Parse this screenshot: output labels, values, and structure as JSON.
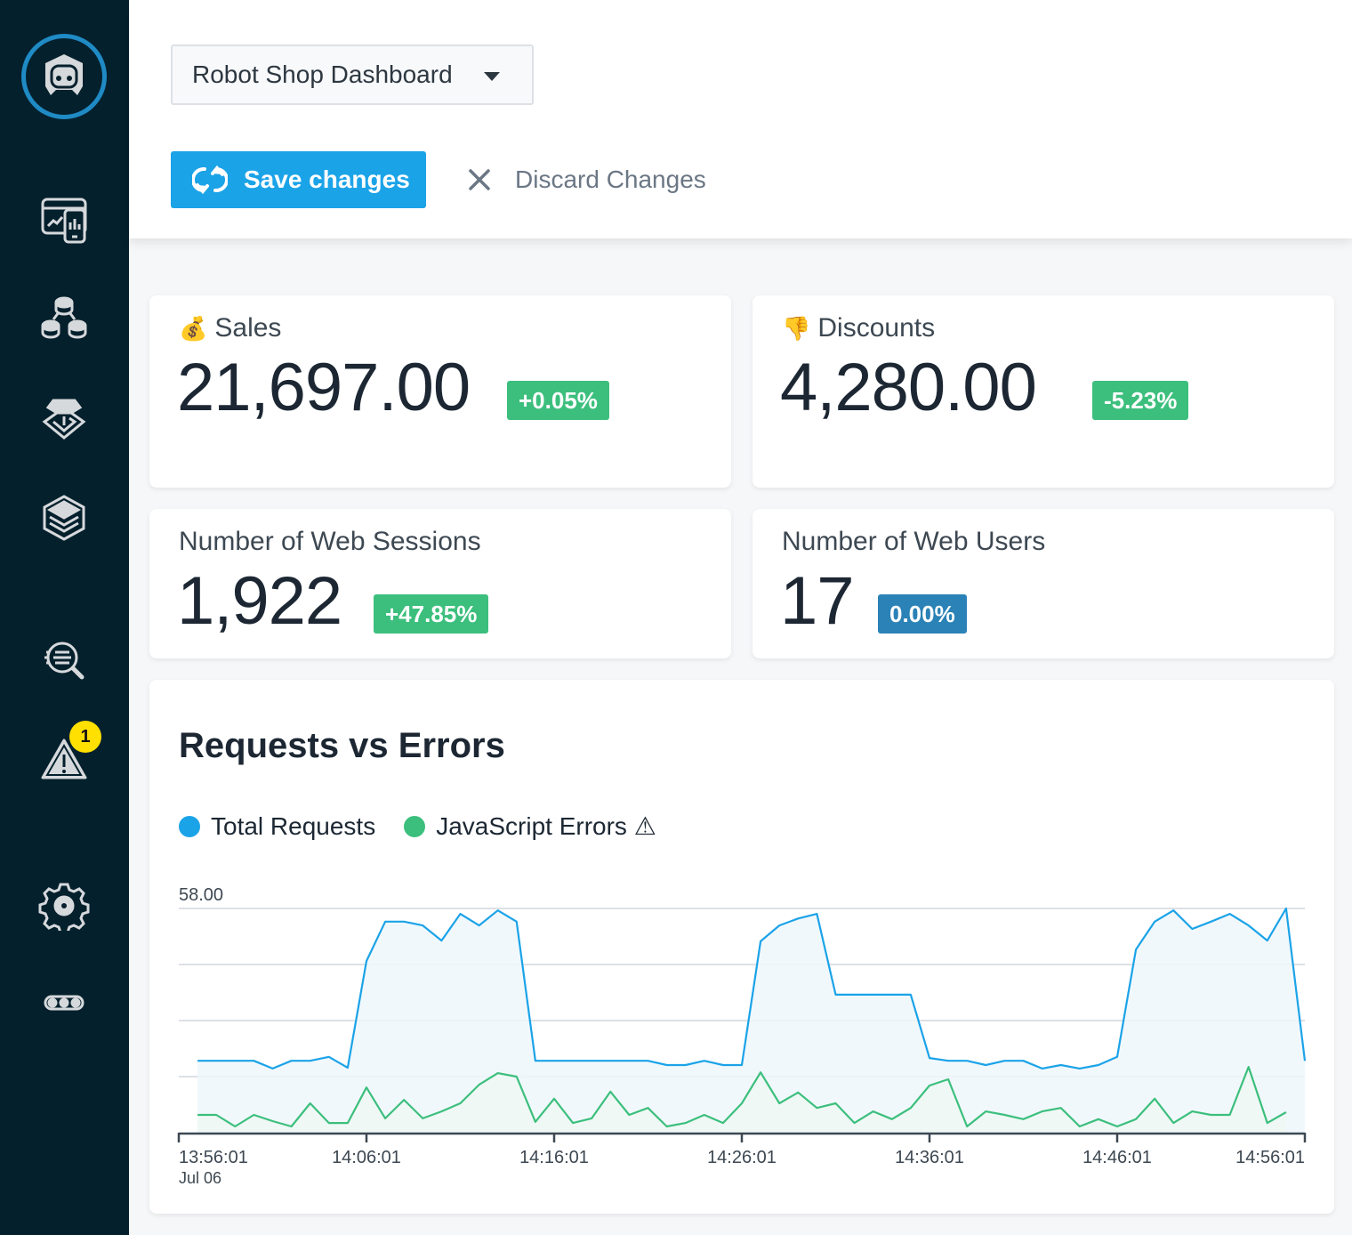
{
  "header": {
    "dashboard_select": {
      "selected": "Robot Shop Dashboard"
    },
    "save_label": "Save changes",
    "discard_label": "Discard Changes"
  },
  "sidebar": {
    "items": [
      {
        "name": "logo",
        "icon": "robot-logo-icon"
      },
      {
        "name": "monitoring",
        "icon": "browser-mobile-monitoring-icon"
      },
      {
        "name": "services",
        "icon": "services-topology-icon"
      },
      {
        "name": "infrastructure",
        "icon": "infrastructure-icon"
      },
      {
        "name": "layers",
        "icon": "layers-stack-icon"
      },
      {
        "name": "analyze",
        "icon": "search-analyze-icon"
      },
      {
        "name": "events",
        "icon": "warning-icon",
        "badge": "1"
      },
      {
        "name": "settings",
        "icon": "gear-icon"
      },
      {
        "name": "more",
        "icon": "more-icon"
      }
    ]
  },
  "metrics": [
    {
      "id": "sales",
      "emoji": "💰",
      "label": "Sales",
      "value": "21,697.00",
      "change": "+0.05%",
      "change_color": "#3cbf7d"
    },
    {
      "id": "discounts",
      "emoji": "👎",
      "label": "Discounts",
      "value": "4,280.00",
      "change": "-5.23%",
      "change_color": "#3cbf7d"
    },
    {
      "id": "sessions",
      "emoji": "",
      "label": "Number of Web Sessions",
      "value": "1,922",
      "change": "+47.85%",
      "change_color": "#3cbf7d"
    },
    {
      "id": "users",
      "emoji": "",
      "label": "Number of Web Users",
      "value": "17",
      "change": "0.00%",
      "change_color": "#2a82b6"
    }
  ],
  "chart_data": {
    "type": "area",
    "title": "Requests vs Errors",
    "xlabel": "",
    "ylabel": "",
    "y_max_label": "58.00",
    "ylim": [
      0,
      58
    ],
    "grid": true,
    "legend_position": "top-left",
    "x_range_minutes": [
      0,
      60
    ],
    "x_ticks": [
      {
        "minute": 0,
        "label": "13:56:01",
        "sublabel": "Jul 06"
      },
      {
        "minute": 10,
        "label": "14:06:01",
        "sublabel": ""
      },
      {
        "minute": 20,
        "label": "14:16:01",
        "sublabel": ""
      },
      {
        "minute": 30,
        "label": "14:26:01",
        "sublabel": ""
      },
      {
        "minute": 40,
        "label": "14:36:01",
        "sublabel": ""
      },
      {
        "minute": 50,
        "label": "14:46:01",
        "sublabel": ""
      },
      {
        "minute": 60,
        "label": "14:56:01",
        "sublabel": ""
      }
    ],
    "x_start_minute": 1,
    "x_step_minutes": 1,
    "series": [
      {
        "name": "Total Requests",
        "color": "#1ba3e8",
        "fill": "#eef7fc",
        "values": [
          18.6,
          18.6,
          18.6,
          18.6,
          16.6,
          18.6,
          18.6,
          19.6,
          16.8,
          44.4,
          54.6,
          54.6,
          53.6,
          49.7,
          56.6,
          53.6,
          57.5,
          54.6,
          18.6,
          18.6,
          18.6,
          18.6,
          18.6,
          18.6,
          18.6,
          17.5,
          17.5,
          18.6,
          17.5,
          17.5,
          49.5,
          53.6,
          55.4,
          56.6,
          35.7,
          35.7,
          35.7,
          35.7,
          35.7,
          19.3,
          18.6,
          18.6,
          17.5,
          18.6,
          18.6,
          16.6,
          17.5,
          16.6,
          17.5,
          19.6,
          47.4,
          54.6,
          57.5,
          52.7,
          54.6,
          56.6,
          53.6,
          49.7,
          58.0,
          18.6
        ]
      },
      {
        "name": "JavaScript Errors ⚠",
        "color": "#3cbf7d",
        "fill": "#eef8f3",
        "values": [
          4.6,
          4.6,
          1.6,
          4.6,
          3.0,
          1.6,
          7.6,
          2.5,
          2.5,
          11.7,
          3.7,
          8.5,
          3.7,
          5.5,
          7.6,
          12.4,
          15.4,
          14.5,
          2.8,
          8.8,
          2.5,
          3.7,
          10.6,
          4.6,
          6.4,
          1.6,
          2.5,
          4.6,
          2.5,
          7.6,
          15.6,
          7.6,
          10.4,
          6.4,
          7.6,
          2.5,
          5.5,
          3.5,
          6.4,
          12.2,
          13.8,
          1.6,
          5.5,
          4.6,
          3.5,
          5.5,
          6.4,
          1.6,
          3.5,
          1.6,
          3.5,
          8.8,
          2.5,
          5.5,
          4.6,
          4.6,
          17.0,
          2.5,
          5.3
        ]
      }
    ]
  }
}
